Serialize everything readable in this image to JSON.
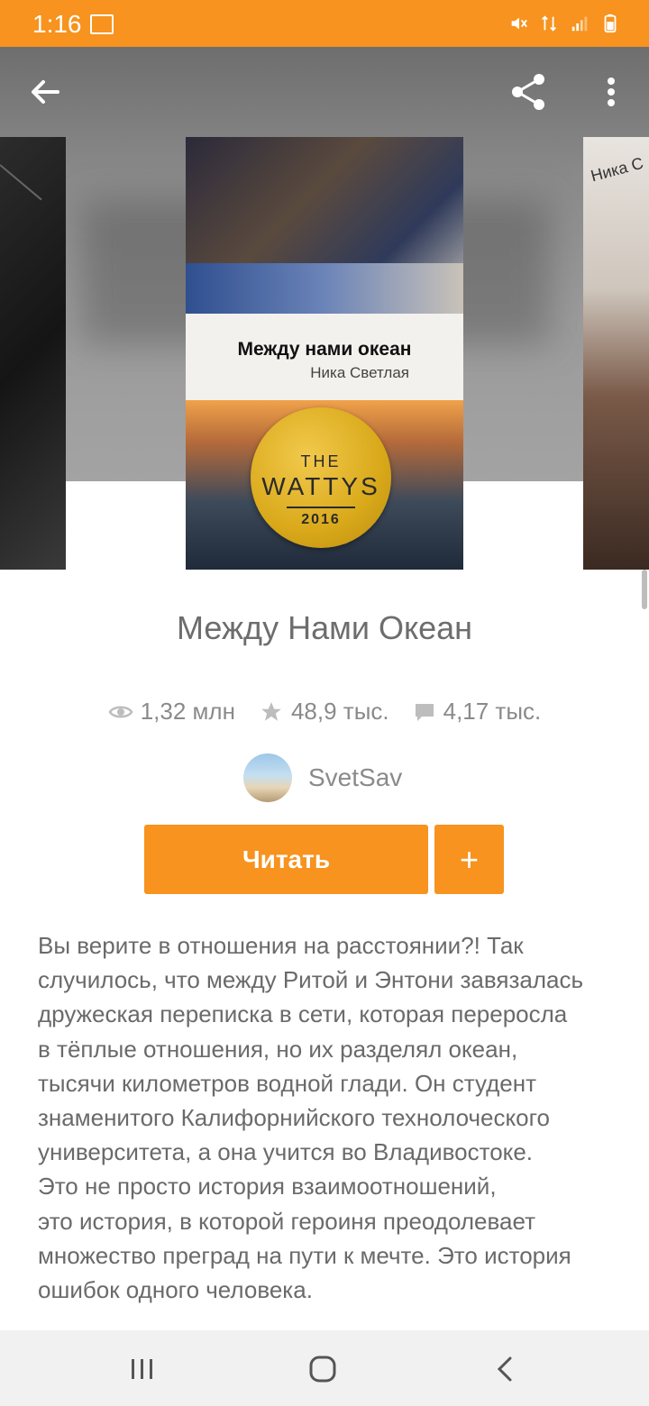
{
  "status_bar": {
    "time": "1:16",
    "icons": [
      "image-icon",
      "mute-icon",
      "data-icon",
      "signal-icon",
      "battery-icon"
    ]
  },
  "toolbar": {
    "back_icon": "arrow-left-icon",
    "share_icon": "share-icon",
    "more_icon": "more-vertical-icon"
  },
  "covers": {
    "left_visible_text": "",
    "right_visible_text": "Ника С",
    "main": {
      "title": "Между нами океан",
      "author": "Ника Светлая",
      "badge_the": "THE",
      "badge_name": "WATTYS",
      "badge_year": "2016"
    }
  },
  "book": {
    "title": "Между Нами Океан",
    "stats": {
      "views": "1,32 млн",
      "votes": "48,9 тыс.",
      "comments": "4,17 тыс."
    },
    "author": "SvetSav",
    "read_label": "Читать",
    "add_label": "+",
    "description": "Вы верите в отношения на расстоянии?! Так\nслучилось, что между Ритой и Энтони завязалась\nдружеская переписка в сети, которая переросла\nв тёплые отношения, но их разделял океан,\nтысячи километров водной глади. Он студент\nзнаменитого Калифорнийского технолоческого\nуниверситета,  а она учится во Владивостоке.\nЭто не просто история взаимоотношений,\nэто история, в которой героиня преодолевает\nмножество преград на пути к мечте. Это история\nошибок одного человека."
  },
  "colors": {
    "accent": "#f7931e",
    "text_secondary": "#8a8a8a",
    "nav_bar": "#f1f1f1"
  },
  "nav": {
    "recents_icon": "recents-icon",
    "home_icon": "home-icon",
    "back_icon": "back-icon"
  }
}
